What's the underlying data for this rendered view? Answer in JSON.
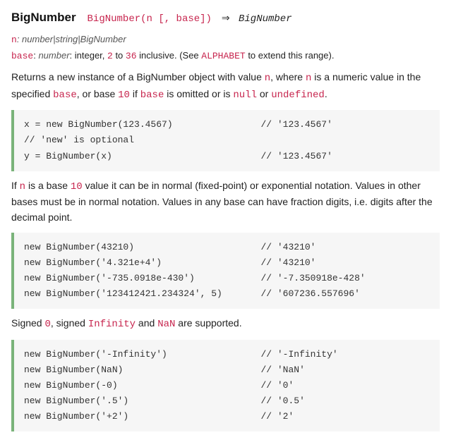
{
  "header": {
    "title": "BigNumber",
    "signature": "BigNumber(n [, base])",
    "arrow": "⇒",
    "returnType": "BigNumber"
  },
  "params": {
    "n_name": "n",
    "n_type": ": number|string|BigNumber",
    "base_name": "base",
    "base_sep": ": ",
    "base_type": "number",
    "base_desc1": ": integer, ",
    "base_min": "2",
    "base_desc2": " to ",
    "base_max": "36",
    "base_desc3": " inclusive. (See ",
    "alphabet_link": "ALPHABET",
    "base_desc4": " to extend this range)."
  },
  "desc1": {
    "t1": "Returns a new instance of a BigNumber object with value ",
    "c1": "n",
    "t2": ", where ",
    "c2": "n",
    "t3": " is a numeric value in the specified ",
    "c3": "base",
    "t4": ", or base ",
    "c4": "10",
    "t5": " if ",
    "c5": "base",
    "t6": " is omitted or is ",
    "c6": "null",
    "t7": " or ",
    "c7": "undefined",
    "t8": "."
  },
  "code1": "x = new BigNumber(123.4567)                // '123.4567'\n// 'new' is optional\ny = BigNumber(x)                           // '123.4567'",
  "desc2": {
    "t1": "If ",
    "c1": "n",
    "t2": " is a base ",
    "c2": "10",
    "t3": " value it can be in normal (fixed-point) or exponential notation. Values in other bases must be in normal notation. Values in any base can have fraction digits, i.e. digits after the decimal point."
  },
  "code2": "new BigNumber(43210)                       // '43210'\nnew BigNumber('4.321e+4')                  // '43210'\nnew BigNumber('-735.0918e-430')            // '-7.350918e-428'\nnew BigNumber('123412421.234324', 5)       // '607236.557696'",
  "desc3": {
    "t1": "Signed ",
    "c1": "0",
    "t2": ", signed ",
    "c2": "Infinity",
    "t3": " and ",
    "c3": "NaN",
    "t4": " are supported."
  },
  "code3": "new BigNumber('-Infinity')                 // '-Infinity'\nnew BigNumber(NaN)                         // 'NaN'\nnew BigNumber(-0)                          // '0'\nnew BigNumber('.5')                        // '0.5'\nnew BigNumber('+2')                        // '2'"
}
